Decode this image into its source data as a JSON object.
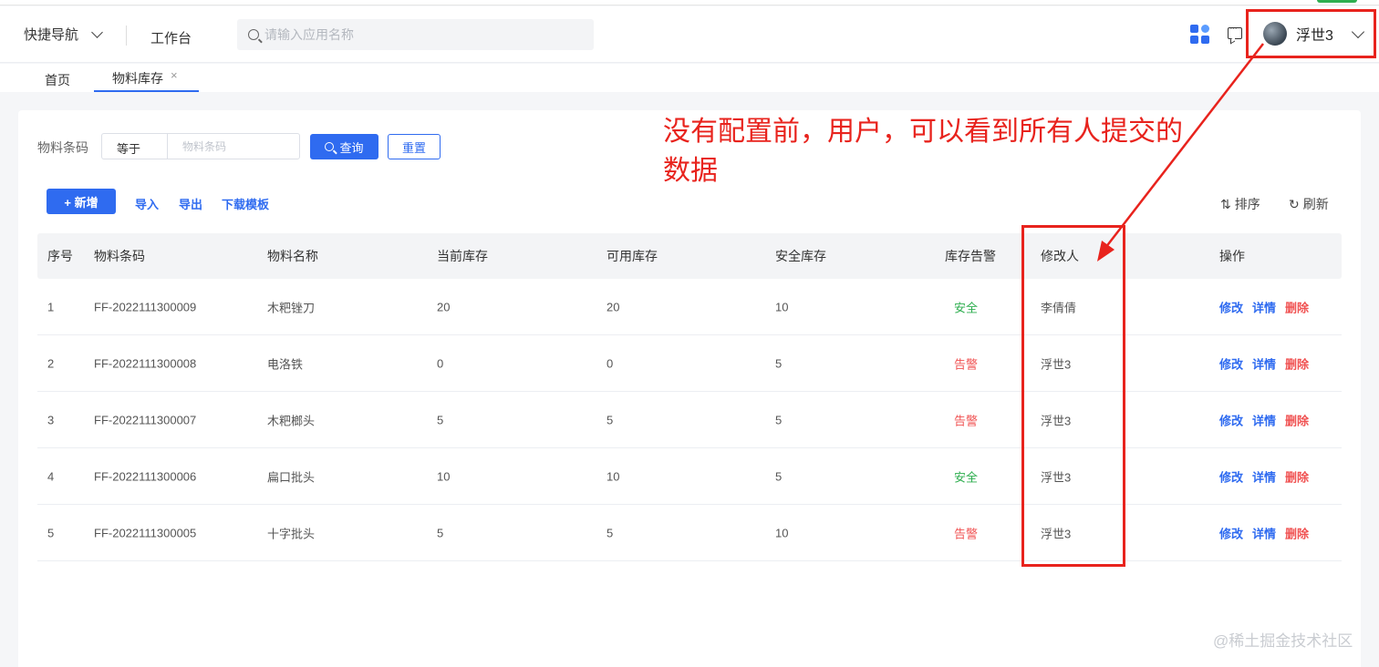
{
  "header": {
    "quick_nav": "快捷导航",
    "workbench": "工作台",
    "search_placeholder": "请输入应用名称",
    "user_name": "浮世3"
  },
  "tabs": [
    {
      "label": "首页"
    },
    {
      "label": "物料库存",
      "close": "×",
      "active": true
    }
  ],
  "filter": {
    "label": "物料条码",
    "operator": "等于",
    "placeholder": "物料条码",
    "query_label": "查询",
    "reset_label": "重置"
  },
  "toolbar": {
    "add_label": "+ 新增",
    "import_label": "导入",
    "export_label": "导出",
    "template_label": "下载模板",
    "sort_label": "排序",
    "refresh_label": "刷新"
  },
  "table": {
    "columns": [
      "序号",
      "物料条码",
      "物料名称",
      "当前库存",
      "可用库存",
      "安全库存",
      "库存告警",
      "修改人",
      "操作"
    ],
    "rows": [
      {
        "no": "1",
        "code": "FF-2022111300009",
        "name": "木粑锉刀",
        "current": "20",
        "available": "20",
        "safety": "10",
        "alarm": "安全",
        "modifier": "李倩倩"
      },
      {
        "no": "2",
        "code": "FF-2022111300008",
        "name": "电洛铁",
        "current": "0",
        "available": "0",
        "safety": "5",
        "alarm": "告警",
        "modifier": "浮世3"
      },
      {
        "no": "3",
        "code": "FF-2022111300007",
        "name": "木粑榔头",
        "current": "5",
        "available": "5",
        "safety": "5",
        "alarm": "告警",
        "modifier": "浮世3"
      },
      {
        "no": "4",
        "code": "FF-2022111300006",
        "name": "扁口批头",
        "current": "10",
        "available": "10",
        "safety": "5",
        "alarm": "安全",
        "modifier": "浮世3"
      },
      {
        "no": "5",
        "code": "FF-2022111300005",
        "name": "十字批头",
        "current": "5",
        "available": "5",
        "safety": "10",
        "alarm": "告警",
        "modifier": "浮世3"
      }
    ],
    "ops": {
      "edit": "修改",
      "detail": "详情",
      "delete": "删除"
    }
  },
  "annotation": {
    "text": "没有配置前，用户，可以看到所有人提交的数据"
  },
  "watermark": "@稀土掘金技术社区",
  "colors": {
    "primary": "#2f6bf0",
    "safe": "#2eae4f",
    "alarm": "#f05252",
    "annotation": "#e8231d"
  }
}
